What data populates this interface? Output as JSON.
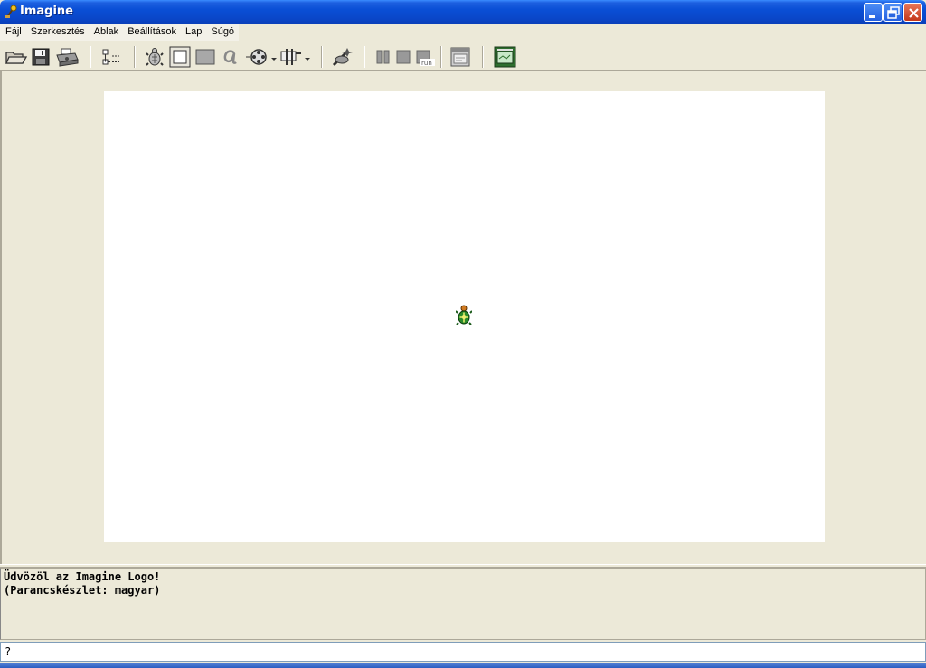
{
  "window": {
    "title": "Imagine"
  },
  "menu": {
    "items": [
      "Fájl",
      "Szerkesztés",
      "Ablak",
      "Beállítások",
      "Lap",
      "Súgó"
    ]
  },
  "toolbar": {
    "icons": [
      "open-folder-icon",
      "save-icon",
      "print-icon",
      "tree-view-icon",
      "new-turtle-icon",
      "new-frame-icon",
      "new-pane-icon",
      "new-text-icon",
      "new-media-icon",
      "new-button-icon",
      "magic-wand-icon",
      "pause-icon",
      "stop-icon",
      "run-icon",
      "page-window-icon",
      "presentation-icon"
    ]
  },
  "output": {
    "lines": [
      "Üdvözöl az Imagine Logo!",
      "(Parancskészlet: magyar)"
    ]
  },
  "command": {
    "value": "?"
  }
}
